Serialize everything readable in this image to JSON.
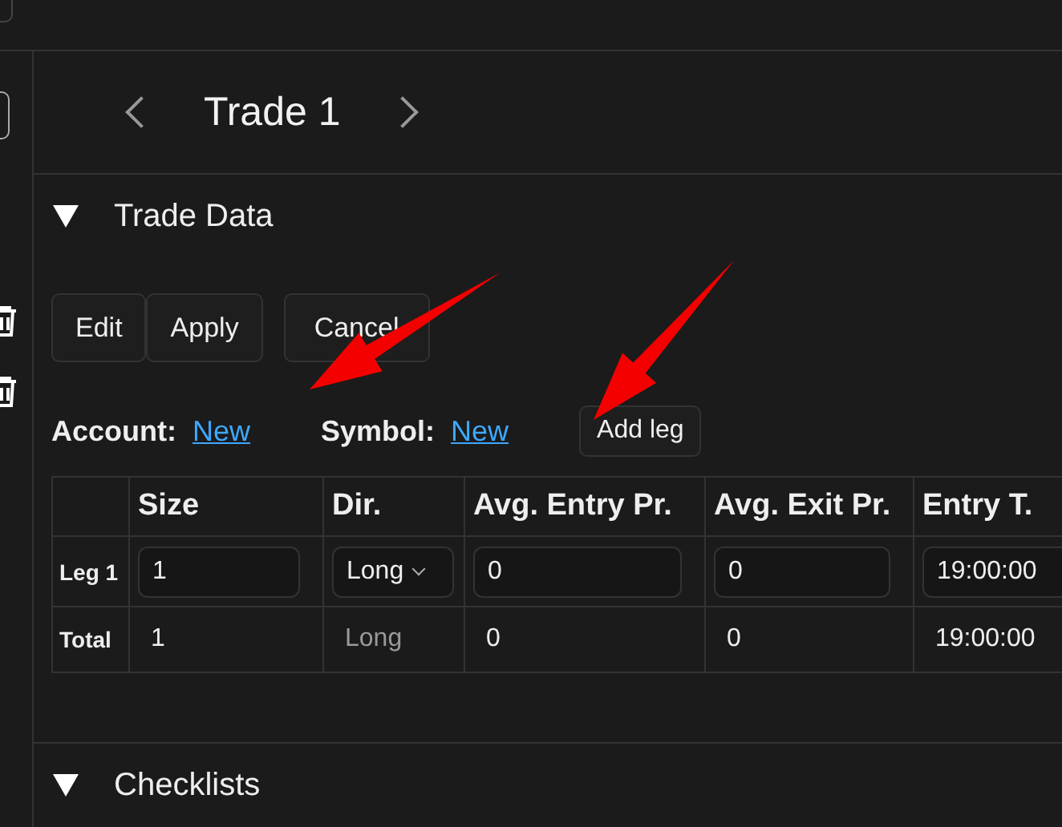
{
  "header": {
    "title": "Trade 1"
  },
  "sections": [
    {
      "title": "Trade Data",
      "expanded": true
    },
    {
      "title": "Checklists",
      "expanded": true
    }
  ],
  "trade_data": {
    "buttons": [
      "Edit",
      "Apply",
      "Cancel"
    ],
    "account": {
      "label": "Account:",
      "value": "New"
    },
    "symbol": {
      "label": "Symbol:",
      "value": "New"
    },
    "add_leg": "Add leg",
    "table": {
      "columns": [
        {
          "label": "Size",
          "kind": "text"
        },
        {
          "label": "Dir.",
          "kind": "select"
        },
        {
          "label": "Avg. Entry Pr.",
          "kind": "text"
        },
        {
          "label": "Avg. Exit Pr.",
          "kind": "text"
        },
        {
          "label": "Entry T.",
          "kind": "text"
        }
      ],
      "rows": [
        {
          "label": "Leg 1",
          "editable": true,
          "cells": [
            "1",
            "Long",
            "0",
            "0",
            "19:00:00"
          ]
        },
        {
          "label": "Total",
          "editable": false,
          "cells": [
            "1",
            "Long",
            "0",
            "0",
            "19:00:00"
          ]
        }
      ]
    }
  }
}
